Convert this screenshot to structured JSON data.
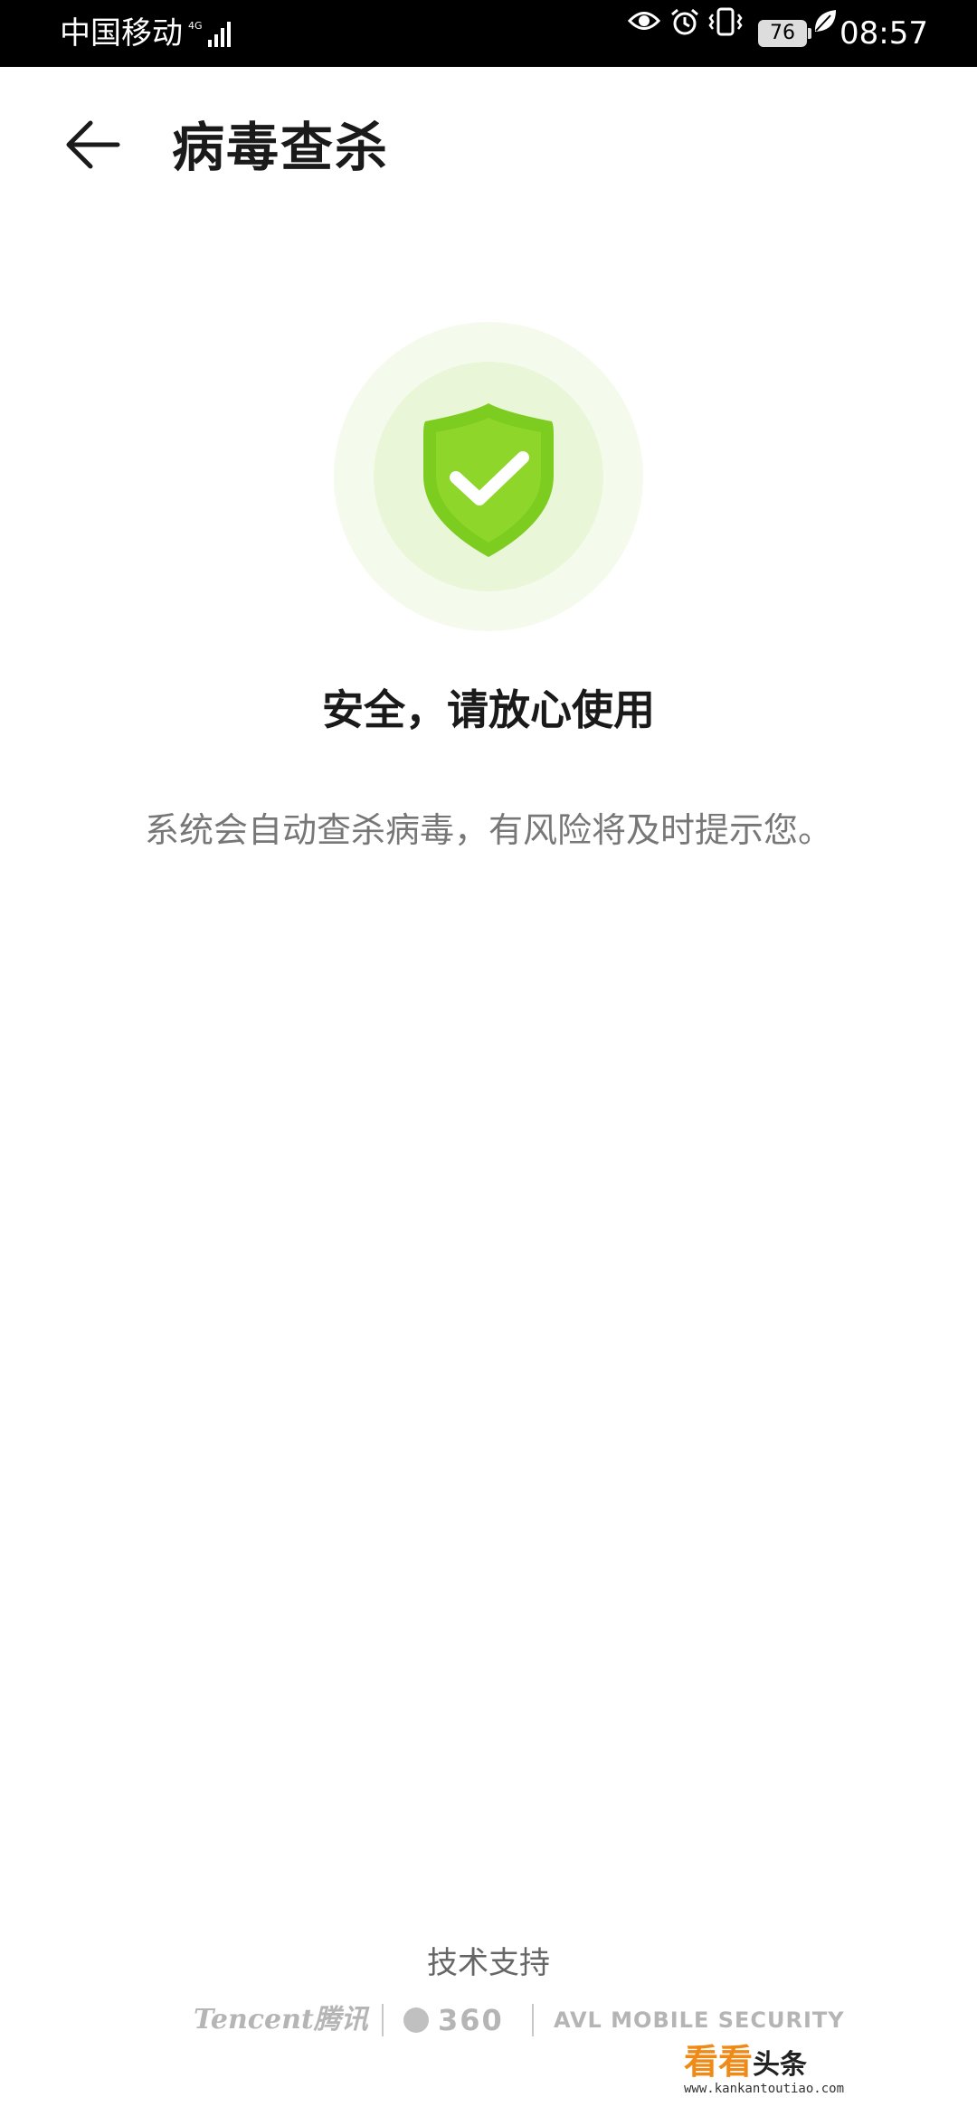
{
  "status_bar": {
    "carrier": "中国移动",
    "network": "4G",
    "battery": "76",
    "time": "08:57"
  },
  "header": {
    "back_icon": "arrow-left-icon",
    "title": "病毒查杀"
  },
  "status": {
    "icon": "shield-check-icon",
    "heading": "安全，请放心使用",
    "description": "系统会自动查杀病毒，有风险将及时提示您。"
  },
  "footer": {
    "tech_support": "技术支持",
    "partners": {
      "tencent": "Tencent腾讯",
      "p360": "360",
      "avl": "AVL MOBILE SECURITY"
    }
  },
  "watermark": {
    "brand_orange": "看看",
    "brand_black": "头条",
    "url": "www.kankantoutiao.com"
  },
  "colors": {
    "accent_green": "#7ccd1f",
    "shield_light": "#9ad92f",
    "halo_outer": "#f5fbec",
    "halo_inner": "#e9f6d8"
  }
}
